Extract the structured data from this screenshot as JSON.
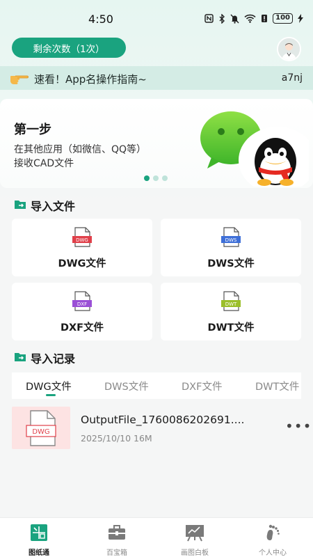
{
  "status_bar": {
    "time": "4:50",
    "battery": "100"
  },
  "header": {
    "remaining_label": "剩余次数（1次）"
  },
  "notice": {
    "text": "速看！App名操作指南~",
    "code": "a7nj"
  },
  "banner": {
    "title": "第一步",
    "line1": "在其他应用（如微信、QQ等）",
    "line2": "接收CAD文件",
    "pages": 3,
    "active_page": 0
  },
  "import_section": {
    "title": "导入文件",
    "cards": [
      {
        "label": "DWG文件",
        "badge": "DWG",
        "color": "#e0404a"
      },
      {
        "label": "DWS文件",
        "badge": "DWS",
        "color": "#3e6fd8"
      },
      {
        "label": "DXF文件",
        "badge": "DXF",
        "color": "#9a4fd6"
      },
      {
        "label": "DWT文件",
        "badge": "DWT",
        "color": "#9bbf2a"
      }
    ]
  },
  "records_section": {
    "title": "导入记录",
    "tabs": [
      "DWG文件",
      "DWS文件",
      "DXF文件",
      "DWT文件"
    ],
    "active_tab": 0,
    "items": [
      {
        "name": "OutputFile_1760086202691....",
        "date": "2025/10/10",
        "size": "16M",
        "badge": "DWG"
      }
    ]
  },
  "bottom_nav": {
    "items": [
      {
        "label": "图纸通",
        "icon": "blueprint-icon",
        "active": true
      },
      {
        "label": "百宝箱",
        "icon": "toolbox-icon",
        "active": false
      },
      {
        "label": "画图白板",
        "icon": "whiteboard-icon",
        "active": false
      },
      {
        "label": "个人中心",
        "icon": "footprint-icon",
        "active": false
      }
    ]
  },
  "colors": {
    "accent": "#1aa37f",
    "notice_bg": "#d4ece5"
  }
}
